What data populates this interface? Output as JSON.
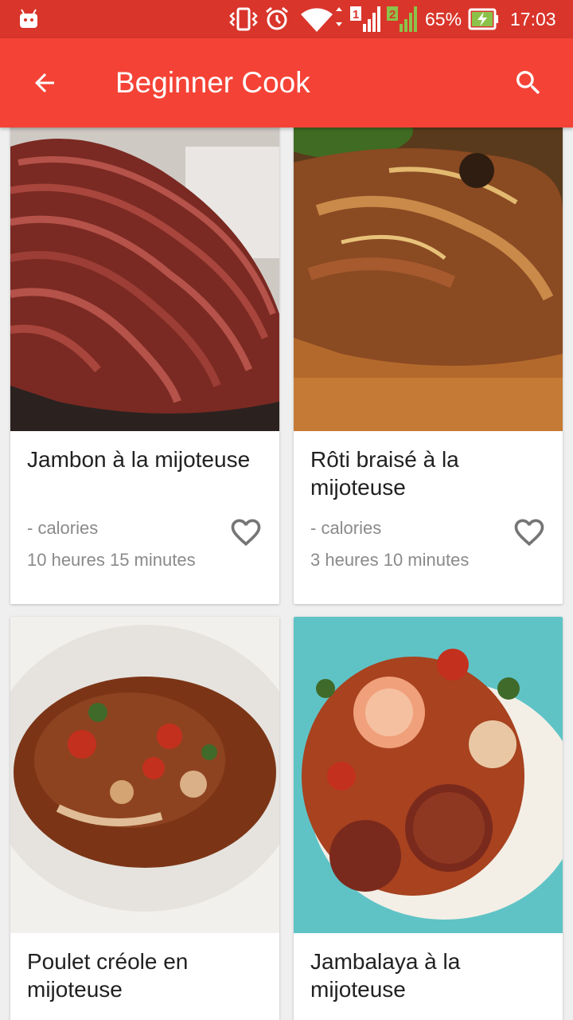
{
  "status_bar": {
    "battery": "65%",
    "time": "17:03",
    "sim1": "1",
    "sim2": "2",
    "icons": [
      "android-icon",
      "vibrate-icon",
      "alarm-icon",
      "wifi-icon",
      "signal-icon",
      "battery-charging-icon"
    ]
  },
  "app_bar": {
    "title": "Beginner Cook",
    "back_icon": "arrow-back-icon",
    "search_icon": "search-icon",
    "color": "#f44336",
    "status_color": "#d9352b"
  },
  "recipes": [
    {
      "name": "Jambon à la mijoteuse",
      "calories": "- calories",
      "time": "10 heures 15 minutes",
      "favorite_icon": "heart-outline-icon"
    },
    {
      "name": "Rôti braisé à la mijoteuse",
      "calories": "- calories",
      "time": "3 heures 10 minutes",
      "favorite_icon": "heart-outline-icon"
    },
    {
      "name": "Poulet créole en mijoteuse",
      "calories": "",
      "time": "",
      "favorite_icon": "heart-outline-icon"
    },
    {
      "name": "Jambalaya à la mijoteuse",
      "calories": "",
      "time": "",
      "favorite_icon": "heart-outline-icon"
    }
  ]
}
